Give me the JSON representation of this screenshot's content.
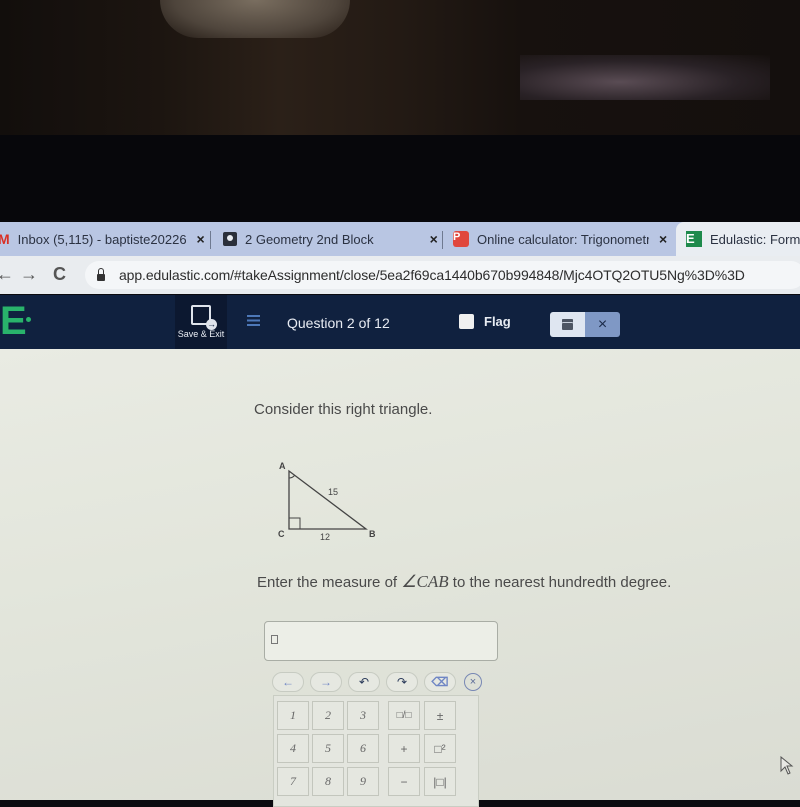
{
  "browser": {
    "tabs": [
      {
        "icon": "gmail-icon",
        "title": "Inbox (5,115) - baptiste20226",
        "close": "×",
        "active": false
      },
      {
        "icon": "classroom-icon",
        "title": "2 Geometry 2nd Block",
        "close": "×",
        "active": false
      },
      {
        "icon": "p-icon",
        "title": "Online calculator: Trigonometr",
        "close": "×",
        "active": false
      },
      {
        "icon": "edulastic-icon",
        "title": "Edulastic: Forma",
        "active": true
      }
    ],
    "nav": {
      "back": "←",
      "forward": "→",
      "reload": "C"
    },
    "url": "app.edulastic.com/#takeAssignment/close/5ea2f69ca1440b670b994848/Mjc4OTQ2OTU5Ng%3D%3D"
  },
  "app_header": {
    "logo": "E",
    "save_exit_label": "Save & Exit",
    "question_counter": "Question 2 of 12",
    "flag_label": "Flag",
    "close_symbol": "×"
  },
  "question": {
    "intro": "Consider this right triangle.",
    "figure": {
      "vertices": {
        "a": "A",
        "b": "B",
        "c": "C"
      },
      "hypotenuse_label": "15",
      "base_label": "12",
      "right_angle_at": "C",
      "marked_angle_at": "A"
    },
    "prompt_before": "Enter the measure of ",
    "prompt_math": "∠CAB",
    "prompt_after": " to the nearest hundredth degree.",
    "answer_value": ""
  },
  "keypad": {
    "nav_keys": [
      "←",
      "→",
      "↶",
      "↷",
      "⌫"
    ],
    "clear_key": "×",
    "keys": [
      [
        "1",
        "2",
        "3",
        "□/□",
        "±"
      ],
      [
        "4",
        "5",
        "6",
        "+",
        "□²"
      ],
      [
        "7",
        "8",
        "9",
        "−",
        "|□|"
      ]
    ]
  }
}
